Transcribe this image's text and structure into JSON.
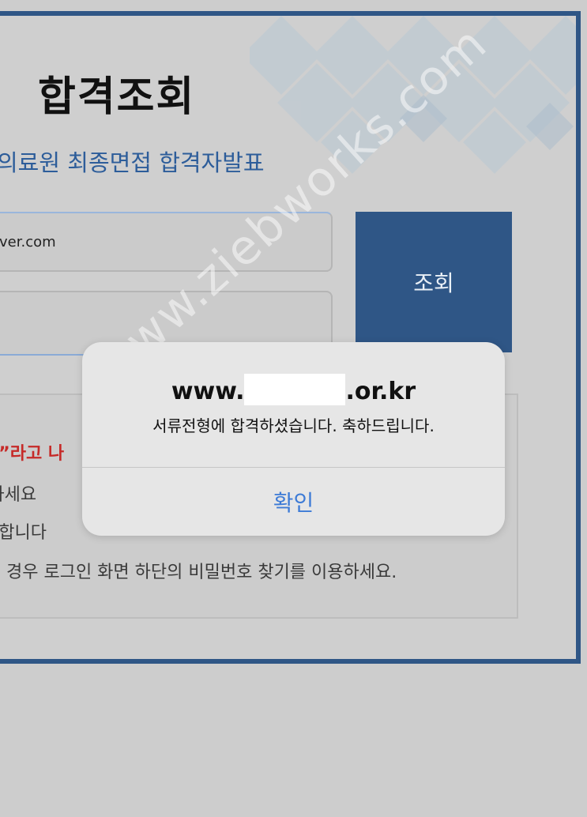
{
  "page": {
    "title": "합격조회",
    "subtitle": "의료원 최종면접 합격자발표"
  },
  "form": {
    "email_value": "aver.com",
    "password_value": "",
    "search_button": "조회"
  },
  "notice": {
    "line1": "다”라고 나",
    "line2": "|하세요",
    "line3": "분합니다",
    "line4": "경우 로그인 화면 하단의 비밀번호 찾기를 이용하세요."
  },
  "alert": {
    "host_prefix": "www.",
    "host_suffix": ".or.kr",
    "message": "서류전형에 합격하셨습니다. 축하드립니다.",
    "confirm_button": "확인"
  },
  "watermark": "www.ziebworks.com",
  "colors": {
    "frame": "#2f5686",
    "button": "#2f5686",
    "subtitle": "#2d5d9a",
    "notice_red": "#c62a28",
    "alert_button": "#3d7bd6"
  }
}
